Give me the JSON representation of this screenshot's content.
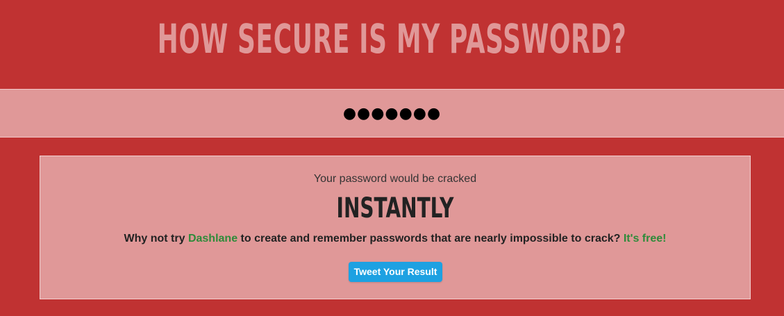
{
  "header": {
    "title": "HOW SECURE IS MY PASSWORD?"
  },
  "password_field": {
    "value": "●●●●●●●"
  },
  "result": {
    "cracked_label": "Your password would be cracked",
    "time_value": "INSTANTLY",
    "promo": {
      "prefix": "Why not try ",
      "dashlane_link": "Dashlane",
      "middle": " to create and remember passwords that are nearly impossible to crack? ",
      "free_link": "It's free!"
    },
    "tweet_button_label": "Tweet Your Result"
  },
  "colors": {
    "background": "#c03232",
    "panel": "#e09898",
    "title": "#e09898",
    "link_green": "#2e8b3a",
    "tweet_blue": "#1da1e2"
  }
}
